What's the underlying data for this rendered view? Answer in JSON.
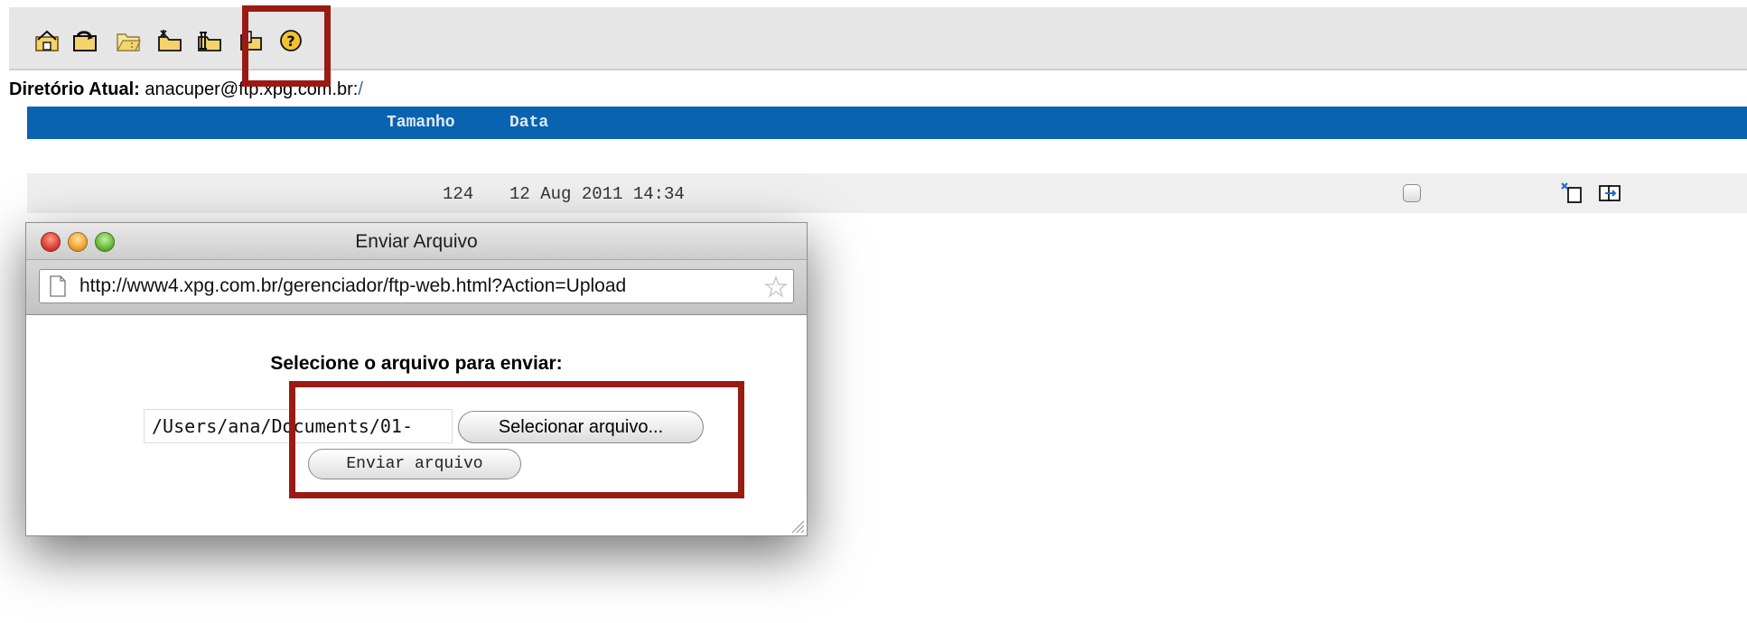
{
  "toolbar": {
    "icons": [
      "home-folder-icon",
      "refresh-icon",
      "parent-folder-icon",
      "new-folder-icon",
      "rename-icon",
      "upload-file-icon",
      "help-icon"
    ]
  },
  "current_dir": {
    "label": "Diretório Atual:",
    "path": "anacuper@ftp.xpg.com.br:",
    "slash": "/"
  },
  "table": {
    "headers": {
      "size": "Tamanho",
      "date": "Data"
    },
    "rows": [
      {
        "size": "124",
        "date": "12 Aug 2011 14:34"
      }
    ]
  },
  "popup": {
    "title": "Enviar Arquivo",
    "url": "http://www4.xpg.com.br/gerenciador/ftp-web.html?Action=Upload",
    "prompt": "Selecione o arquivo para enviar:",
    "file_path": "/Users/ana/Documents/01-",
    "select_button": "Selecionar arquivo...",
    "send_button": "Enviar arquivo"
  },
  "colors": {
    "header_bg": "#0a63b0",
    "highlight": "#9a1b14"
  }
}
